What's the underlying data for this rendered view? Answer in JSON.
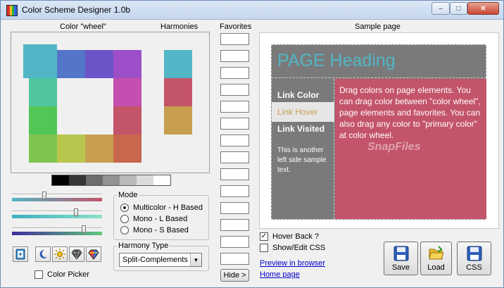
{
  "window": {
    "title": "Color Scheme Designer 1.0b"
  },
  "titlebar_buttons": {
    "minimize": "–",
    "maximize": "□",
    "close": "✕"
  },
  "labels": {
    "wheel": "Color \"wheel\"",
    "harmonies": "Harmonies",
    "favorites": "Favorites",
    "sample_page": "Sample page"
  },
  "wheel_colors": {
    "top_row": [
      "#52b6c6",
      "#5376c9",
      "#6b55c9",
      "#9c4fc8"
    ],
    "right_col": [
      "#c44fb0",
      "#c4546a"
    ],
    "bottom_row": [
      "#7ec44e",
      "#b8c64e",
      "#c89f4e",
      "#c9664e"
    ],
    "left_col": [
      "#4fc69e",
      "#53c656"
    ]
  },
  "harmony_colors": [
    "#52b6c6",
    "#c4546a",
    "#c89f4e"
  ],
  "gray_swatches": [
    "#000000",
    "#363636",
    "#6d6d6d",
    "#939393",
    "#b9b9b9",
    "#dcdcdc",
    "#ffffff"
  ],
  "mode": {
    "legend": "Mode",
    "options": [
      "Multicolor - H Based",
      "Mono - L Based",
      "Mono - S Based"
    ],
    "selected_index": 0
  },
  "harmony_type": {
    "legend": "Harmony Type",
    "selected": "Split-Complements"
  },
  "color_picker": {
    "label": "Color Picker",
    "checked": false
  },
  "hide_button": "Hide >",
  "sample": {
    "heading": "PAGE Heading",
    "heading_color": "#52b6c6",
    "link_color": "Link Color",
    "link_hover": "Link Hover",
    "link_visited": "Link Visited",
    "left_text": "This is another left side sample text.",
    "main_text": "Drag colors on page elements. You can drag color between \"color wheel\", page elements and favorites. You can also drag any color to \"primary color\" at color wheel.",
    "hover_color": "#c89f4e",
    "bg_color": "#7a7a7a",
    "main_bg": "#c4546a",
    "watermark": "SnapFiles"
  },
  "options": {
    "hover_back": {
      "label": "Hover Back ?",
      "checked": true
    },
    "show_css": {
      "label": "Show/Edit CSS",
      "checked": false
    }
  },
  "links": {
    "preview": "Preview in browser",
    "home": "Home page"
  },
  "actions": {
    "save": "Save",
    "load": "Load",
    "css": "CSS"
  }
}
